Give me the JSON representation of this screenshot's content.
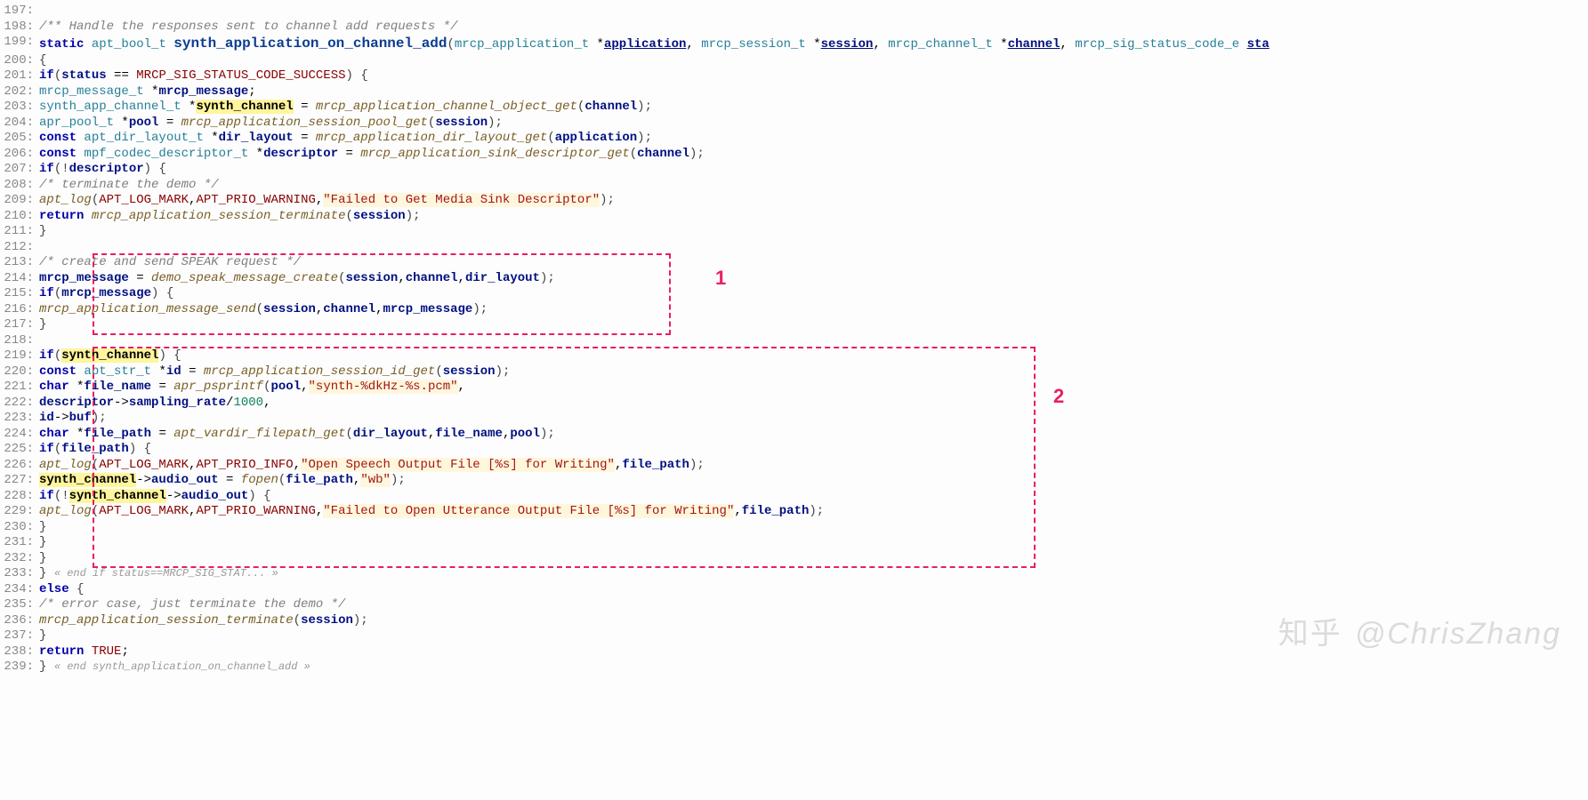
{
  "startLine": 197,
  "annotations": {
    "box1": {
      "label": "1"
    },
    "box2": {
      "label": "2"
    }
  },
  "watermark": {
    "zh": "知乎",
    "en": "@ChrisZhang"
  },
  "lines": [
    {
      "n": 197,
      "html": ""
    },
    {
      "n": 198,
      "html": "<span class='comment'>/** Handle the responses sent to channel add requests */</span>"
    },
    {
      "n": 199,
      "html": "<span class='kw'>static</span> <span class='type'>apt_bool_t</span> <span class='bigfunc'>synth_application_on_channel_add</span><span class='punct'>(</span><span class='type'>mrcp_application_t</span> *<span class='param'>application</span>, <span class='type'>mrcp_session_t</span> *<span class='param'>session</span>, <span class='type'>mrcp_channel_t</span> *<span class='param'>channel</span>, <span class='type'>mrcp_sig_status_code_e</span> <span class='param'>sta</span>"
    },
    {
      "n": 200,
      "html": "<span class='punct'>{</span>"
    },
    {
      "n": 201,
      "html": "    <span class='kw'>if</span><span class='punct'>(</span><span class='var'>status</span> <span class='op'>==</span> <span class='const'>MRCP_SIG_STATUS_CODE_SUCCESS</span><span class='punct'>) {</span>"
    },
    {
      "n": 202,
      "html": "        <span class='type'>mrcp_message_t</span> *<span class='var'>mrcp_message</span>;"
    },
    {
      "n": 203,
      "html": "        <span class='type'>synth_app_channel_t</span> *<span class='hl'>synth_channel</span> = <span class='func'>mrcp_application_channel_object_get</span><span class='punct'>(</span><span class='var'>channel</span><span class='punct'>);</span>"
    },
    {
      "n": 204,
      "html": "        <span class='type'>apr_pool_t</span> *<span class='var'>pool</span> = <span class='func'>mrcp_application_session_pool_get</span><span class='punct'>(</span><span class='var'>session</span><span class='punct'>);</span>"
    },
    {
      "n": 205,
      "html": "        <span class='kw'>const</span> <span class='type'>apt_dir_layout_t</span> *<span class='var'>dir_layout</span> = <span class='func'>mrcp_application_dir_layout_get</span><span class='punct'>(</span><span class='var'>application</span><span class='punct'>);</span>"
    },
    {
      "n": 206,
      "html": "        <span class='kw'>const</span> <span class='type'>mpf_codec_descriptor_t</span> *<span class='var'>descriptor</span> = <span class='func'>mrcp_application_sink_descriptor_get</span><span class='punct'>(</span><span class='var'>channel</span><span class='punct'>);</span>"
    },
    {
      "n": 207,
      "html": "        <span class='kw'>if</span><span class='punct'>(!</span><span class='var'>descriptor</span><span class='punct'>) {</span>"
    },
    {
      "n": 208,
      "html": "            <span class='comment'>/* terminate the demo */</span>"
    },
    {
      "n": 209,
      "html": "            <span class='func'>apt_log</span><span class='punct'>(</span><span class='const'>APT_LOG_MARK</span>,<span class='const'>APT_PRIO_WARNING</span>,<span class='str'>\"Failed to Get Media Sink Descriptor\"</span><span class='punct'>);</span>"
    },
    {
      "n": 210,
      "html": "            <span class='kw'>return</span> <span class='func'>mrcp_application_session_terminate</span><span class='punct'>(</span><span class='var'>session</span><span class='punct'>);</span>"
    },
    {
      "n": 211,
      "html": "        <span class='punct'>}</span>"
    },
    {
      "n": 212,
      "html": ""
    },
    {
      "n": 213,
      "html": "        <span class='comment'>/* create and send SPEAK request */</span>"
    },
    {
      "n": 214,
      "html": "        <span class='var'>mrcp_message</span> = <span class='func'>demo_speak_message_create</span><span class='punct'>(</span><span class='var'>session</span>,<span class='var'>channel</span>,<span class='var'>dir_layout</span><span class='punct'>);</span>"
    },
    {
      "n": 215,
      "html": "        <span class='kw'>if</span><span class='punct'>(</span><span class='var'>mrcp_message</span><span class='punct'>) {</span>"
    },
    {
      "n": 216,
      "html": "            <span class='func'>mrcp_application_message_send</span><span class='punct'>(</span><span class='var'>session</span>,<span class='var'>channel</span>,<span class='var'>mrcp_message</span><span class='punct'>);</span>"
    },
    {
      "n": 217,
      "html": "        <span class='punct'>}</span>"
    },
    {
      "n": 218,
      "html": ""
    },
    {
      "n": 219,
      "html": "        <span class='kw'>if</span><span class='punct'>(</span><span class='hl'>synth_channel</span><span class='punct'>) {</span>"
    },
    {
      "n": 220,
      "html": "            <span class='kw'>const</span> <span class='type'>apt_str_t</span> *<span class='var'>id</span> = <span class='func'>mrcp_application_session_id_get</span><span class='punct'>(</span><span class='var'>session</span><span class='punct'>);</span>"
    },
    {
      "n": 221,
      "html": "            <span class='kw'>char</span> *<span class='var'>file_name</span> = <span class='func'>apr_psprintf</span><span class='punct'>(</span><span class='var'>pool</span>,<span class='str'>\"synth-%dkHz-%s.pcm\"</span>,"
    },
    {
      "n": 222,
      "html": "                                            <span class='var'>descriptor</span>-&gt;<span class='var'>sampling_rate</span>/<span class='num'>1000</span>,"
    },
    {
      "n": 223,
      "html": "                                            <span class='var'>id</span>-&gt;<span class='var'>buf</span><span class='punct'>);</span>"
    },
    {
      "n": 224,
      "html": "            <span class='kw'>char</span> *<span class='var'>file_path</span> = <span class='func'>apt_vardir_filepath_get</span><span class='punct'>(</span><span class='var'>dir_layout</span>,<span class='var'>file_name</span>,<span class='var'>pool</span><span class='punct'>);</span>"
    },
    {
      "n": 225,
      "html": "            <span class='kw'>if</span><span class='punct'>(</span><span class='var'>file_path</span><span class='punct'>) {</span>"
    },
    {
      "n": 226,
      "html": "                <span class='func'>apt_log</span><span class='punct'>(</span><span class='const'>APT_LOG_MARK</span>,<span class='const'>APT_PRIO_INFO</span>,<span class='str'>\"Open Speech Output File [%s] for Writing\"</span>,<span class='var'>file_path</span><span class='punct'>);</span>"
    },
    {
      "n": 227,
      "html": "                <span class='hl'>synth_channel</span>-&gt;<span class='var'>audio_out</span> = <span class='func'>fopen</span><span class='punct'>(</span><span class='var'>file_path</span>,<span class='str'>\"wb\"</span><span class='punct'>);</span>"
    },
    {
      "n": 228,
      "html": "                <span class='kw'>if</span><span class='punct'>(!</span><span class='hl'>synth_channel</span>-&gt;<span class='var'>audio_out</span><span class='punct'>) {</span>"
    },
    {
      "n": 229,
      "html": "                    <span class='func'>apt_log</span><span class='punct'>(</span><span class='const'>APT_LOG_MARK</span>,<span class='const'>APT_PRIO_WARNING</span>,<span class='str'>\"Failed to Open Utterance Output File [%s] for Writing\"</span>,<span class='var'>file_path</span><span class='punct'>);</span>"
    },
    {
      "n": 230,
      "html": "                <span class='punct'>}</span>"
    },
    {
      "n": 231,
      "html": "            <span class='punct'>}</span>"
    },
    {
      "n": 232,
      "html": "        <span class='punct'>}</span>"
    },
    {
      "n": 233,
      "html": "    <span class='punct'>}</span> <span class='foldhint'>« end if status==MRCP_SIG_STAT... »</span>"
    },
    {
      "n": 234,
      "html": "    <span class='kw'>else</span> <span class='punct'>{</span>"
    },
    {
      "n": 235,
      "html": "        <span class='comment'>/* error case, just terminate the demo */</span>"
    },
    {
      "n": 236,
      "html": "        <span class='func'>mrcp_application_session_terminate</span><span class='punct'>(</span><span class='var'>session</span><span class='punct'>);</span>"
    },
    {
      "n": 237,
      "html": "    <span class='punct'>}</span>"
    },
    {
      "n": 238,
      "html": "    <span class='kw'>return</span> <span class='const'>TRUE</span>;"
    },
    {
      "n": 239,
      "html": "<span class='punct'>}</span> <span class='foldhint'>« end synth_application_on_channel_add »</span>"
    }
  ]
}
